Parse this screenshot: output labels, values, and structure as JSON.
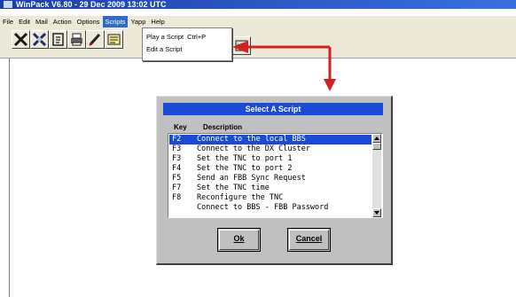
{
  "window": {
    "title": "WinPack V6.80 - 29 Dec 2009 13:02 UTC"
  },
  "menubar": {
    "items": [
      "File",
      "Edit",
      "Mail",
      "Action",
      "Options",
      "Scripts",
      "Yapp",
      "Help"
    ],
    "active": "Scripts"
  },
  "toolbar": {
    "icons": [
      "disconnect-icon",
      "tools-icon",
      "clipboard-icon",
      "printer-icon",
      "edit-icon",
      "script-icon",
      "yapp-icon"
    ]
  },
  "scripts_menu": {
    "items": [
      {
        "label": "Play a Script",
        "shortcut": "Ctrl+P"
      },
      {
        "label": "Edit a Script",
        "shortcut": ""
      }
    ]
  },
  "dialog": {
    "title": "Select A Script",
    "col_key": "Key",
    "col_description": "Description",
    "rows": [
      {
        "key": "F2",
        "description": "Connect to the local BBS",
        "selected": true
      },
      {
        "key": "F3",
        "description": "Connect to the DX Cluster",
        "selected": false
      },
      {
        "key": "F3",
        "description": "Set the TNC to port 1",
        "selected": false
      },
      {
        "key": "F4",
        "description": "Set the TNC to port 2",
        "selected": false
      },
      {
        "key": "F5",
        "description": "Send an FBB Sync Request",
        "selected": false
      },
      {
        "key": "F7",
        "description": "Set the TNC time",
        "selected": false
      },
      {
        "key": "F8",
        "description": "Reconfigure the TNC",
        "selected": false
      },
      {
        "key": "",
        "description": "Connect to BBS - FBB Password",
        "selected": false
      }
    ],
    "ok_label": "Ok",
    "cancel_label": "Cancel"
  },
  "colors": {
    "titlebar": "#1b3fa8",
    "dialog_title": "#1a4bd6",
    "selection": "#1a4bd6",
    "annotation_arrow": "#d42020",
    "window_face": "#c0c0c0"
  }
}
